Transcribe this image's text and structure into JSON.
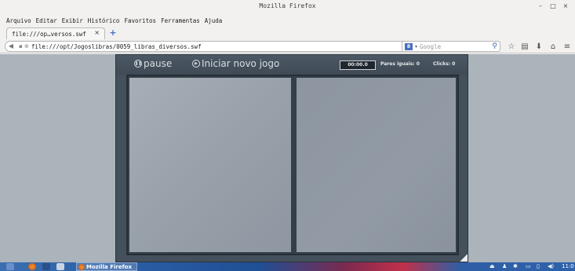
{
  "window": {
    "title": "Mozilla Firefox",
    "minimize": "–",
    "maximize": "□",
    "close": "×"
  },
  "menu": {
    "items": [
      "Arquivo",
      "Editar",
      "Exibir",
      "Histórico",
      "Favoritos",
      "Ferramentas",
      "Ajuda"
    ]
  },
  "tabs": [
    {
      "title": "file:///op…versos.swf",
      "close": "×"
    }
  ],
  "newtab": "+",
  "navbar": {
    "url": "file:///opt/Jogoslibras/0059_libras_diversos.swf",
    "search_placeholder": "Google",
    "search_engine": "g-icon"
  },
  "game": {
    "pause_label": "pause",
    "new_game_label": "Iniciar novo jogo",
    "timer": "00:00.0",
    "pairs_label": "Pares iguais: 0",
    "clicks_label": "Clicks: 0"
  },
  "taskbar": {
    "firefox_label": "Mozilla Firefox",
    "clock": "11:0"
  },
  "colors": {
    "content_bg": "#abb3bb",
    "flash_bg": "#44505c",
    "accent": "#4a6fc1"
  }
}
